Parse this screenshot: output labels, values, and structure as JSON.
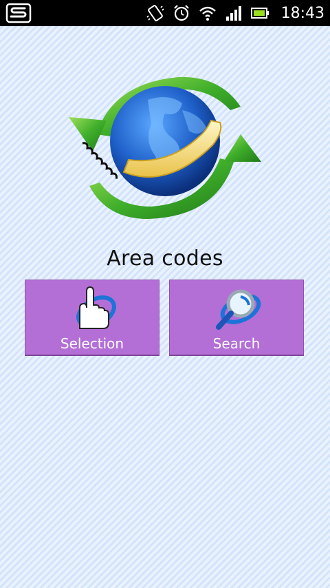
{
  "status_bar": {
    "time": "18:43",
    "icons": [
      "s-notification-icon",
      "vibrate-icon",
      "alarm-icon",
      "wifi-icon",
      "signal-icon",
      "battery-icon"
    ]
  },
  "app": {
    "logo_icon": "globe-phone-arrows-icon",
    "title": "Area codes"
  },
  "buttons": {
    "selection": {
      "label": "Selection",
      "icon": "pointing-hand-icon"
    },
    "search": {
      "label": "Search",
      "icon": "magnifier-icon"
    }
  },
  "colors": {
    "button_bg": "#b36fd6",
    "button_text": "#ffffff",
    "status_bar_bg": "#000000",
    "background": "#ddeafb"
  }
}
